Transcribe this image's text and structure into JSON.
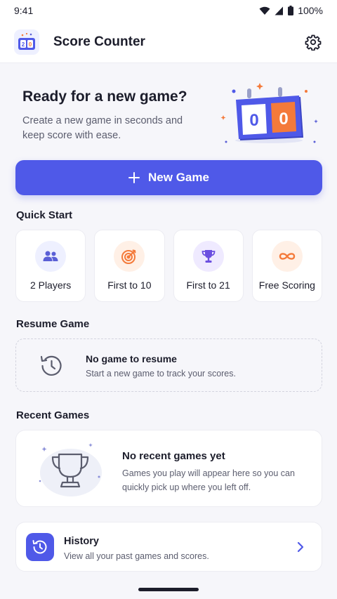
{
  "status_bar": {
    "time": "9:41",
    "battery": "100%"
  },
  "header": {
    "title": "Score Counter",
    "logo_digits": [
      "2",
      "0"
    ]
  },
  "hero": {
    "title": "Ready for a new game?",
    "subtitle": "Create a new game in seconds and keep score with ease.",
    "scoreboard_digits": [
      "0",
      "0"
    ]
  },
  "new_game": {
    "label": "New Game",
    "icon": "plus-icon"
  },
  "quick_start": {
    "title": "Quick Start",
    "items": [
      {
        "label": "2 Players",
        "icon": "users-icon",
        "color": "#5a5fd6",
        "bg": "#eef0ff"
      },
      {
        "label": "First to 10",
        "icon": "target-icon",
        "color": "#f47a3a",
        "bg": "#fff0e6"
      },
      {
        "label": "First to 21",
        "icon": "trophy-icon",
        "color": "#6b4fe0",
        "bg": "#efeaff"
      },
      {
        "label": "Free Scoring",
        "icon": "infinity-icon",
        "color": "#f47a3a",
        "bg": "#fff0e6"
      }
    ]
  },
  "resume": {
    "title": "Resume Game",
    "empty_title": "No game to resume",
    "empty_subtitle": "Start a new game to track your scores."
  },
  "recent": {
    "title": "Recent Games",
    "empty_title": "No recent games yet",
    "empty_subtitle": "Games you play will appear here so you can quickly pick up where you left off."
  },
  "history": {
    "title": "History",
    "subtitle": "View all your past games and scores."
  },
  "colors": {
    "accent": "#4f59e8",
    "orange": "#f47a3a",
    "background": "#f6f6fa"
  }
}
